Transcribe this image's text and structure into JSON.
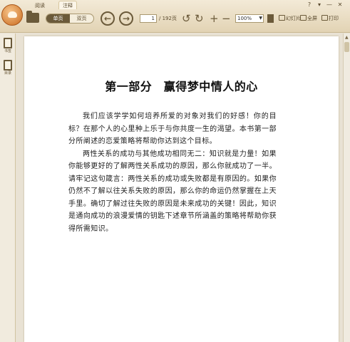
{
  "menu": {
    "read": "阅读",
    "note": "注释"
  },
  "window_controls": [
    "?",
    "▾",
    "—",
    "✕"
  ],
  "toolbar": {
    "view_single": "单页",
    "view_double": "双页",
    "page_current": "1",
    "page_total": "/ 192页",
    "zoom_value": "100%",
    "slideshow": "幻灯片",
    "fullscreen": "全屏",
    "print": "打印"
  },
  "sidebar": {
    "items": [
      {
        "label": "书签",
        "icon": "bookmark-icon"
      },
      {
        "label": "目录",
        "icon": "toc-icon"
      }
    ]
  },
  "document": {
    "title": "第一部分　赢得梦中情人的心",
    "paragraphs": [
      "我们应该学学如何培养所爱的对象对我们的好感！你的目标？在那个人的心里种上乐于与你共度一生的渴望。本书第一部分所阐述的恋爱策略将帮助你达到这个目标。",
      "两性关系的成功与其他成功相同无二：知识就是力量！如果你能够更好的了解两性关系成功的原因，那么你就成功了一半。请牢记这句箴言：两性关系的成功或失败都是有原因的。如果你仍然不了解以往关系失败的原因，那么你的命运仍然掌握在上天手里。确切了解过往失败的原因是未来成功的关键！因此，知识是通向成功的浪漫爱情的钥匙下述章节所涵盖的策略将帮助你获得所需知识。"
    ]
  },
  "colors": {
    "chrome": "#e2d3b4",
    "accent": "#6b5a3a",
    "page": "#ffffff"
  }
}
